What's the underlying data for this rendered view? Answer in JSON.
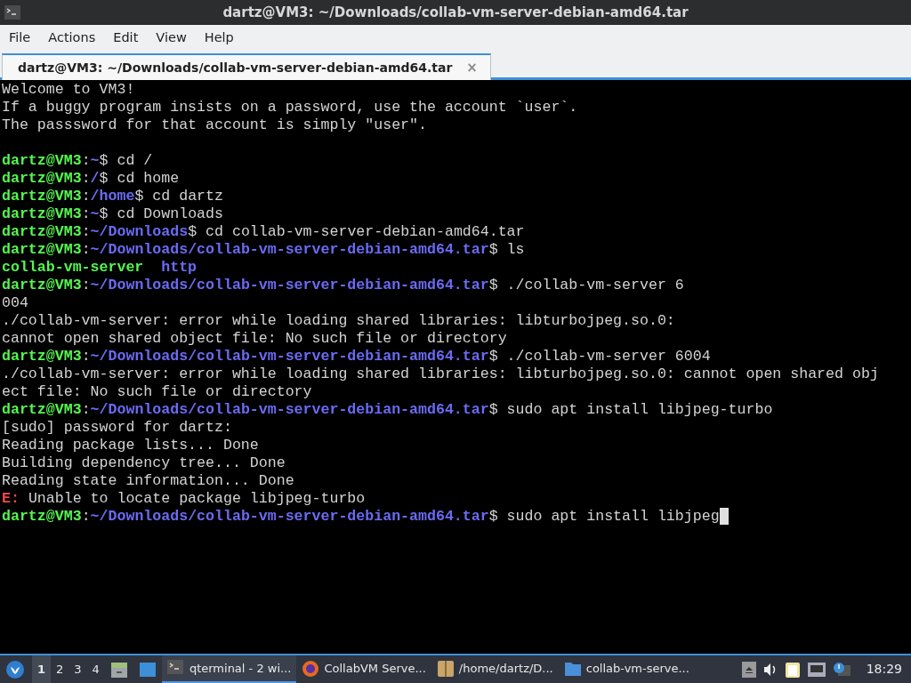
{
  "window": {
    "title": "dartz@VM3: ~/Downloads/collab-vm-server-debian-amd64.tar"
  },
  "menu": [
    "File",
    "Actions",
    "Edit",
    "View",
    "Help"
  ],
  "tabs": [
    {
      "label": "dartz@VM3: ~/Downloads/collab-vm-server-debian-amd64.tar",
      "selected": true,
      "close": "×"
    }
  ],
  "terminal": {
    "lines": [
      {
        "segments": [
          {
            "kind": "text",
            "text": "Welcome to VM3!"
          }
        ]
      },
      {
        "segments": [
          {
            "kind": "text",
            "text": "If a buggy program insists on a password, use the account `user`."
          }
        ]
      },
      {
        "segments": [
          {
            "kind": "text",
            "text": "The passsword for that account is simply \"user\"."
          }
        ]
      },
      {
        "blank": true
      },
      {
        "segments": [
          {
            "kind": "user",
            "text": "dartz@VM3"
          },
          {
            "kind": "text",
            "text": ":"
          },
          {
            "kind": "path",
            "text": "~"
          },
          {
            "kind": "text",
            "text": "$ cd /"
          }
        ]
      },
      {
        "segments": [
          {
            "kind": "user",
            "text": "dartz@VM3"
          },
          {
            "kind": "text",
            "text": ":"
          },
          {
            "kind": "path",
            "text": "/"
          },
          {
            "kind": "text",
            "text": "$ cd home"
          }
        ]
      },
      {
        "segments": [
          {
            "kind": "user",
            "text": "dartz@VM3"
          },
          {
            "kind": "text",
            "text": ":"
          },
          {
            "kind": "path",
            "text": "/home"
          },
          {
            "kind": "text",
            "text": "$ cd dartz"
          }
        ]
      },
      {
        "segments": [
          {
            "kind": "user",
            "text": "dartz@VM3"
          },
          {
            "kind": "text",
            "text": ":"
          },
          {
            "kind": "path",
            "text": "~"
          },
          {
            "kind": "text",
            "text": "$ cd Downloads"
          }
        ]
      },
      {
        "segments": [
          {
            "kind": "user",
            "text": "dartz@VM3"
          },
          {
            "kind": "text",
            "text": ":"
          },
          {
            "kind": "path",
            "text": "~/Downloads"
          },
          {
            "kind": "text",
            "text": "$ cd collab-vm-server-debian-amd64.tar"
          }
        ]
      },
      {
        "segments": [
          {
            "kind": "user",
            "text": "dartz@VM3"
          },
          {
            "kind": "text",
            "text": ":"
          },
          {
            "kind": "path",
            "text": "~/Downloads/collab-vm-server-debian-amd64.tar"
          },
          {
            "kind": "text",
            "text": "$ ls"
          }
        ]
      },
      {
        "segments": [
          {
            "kind": "exec",
            "text": "collab-vm-server"
          },
          {
            "kind": "dir",
            "text": "http"
          }
        ]
      },
      {
        "segments": [
          {
            "kind": "user",
            "text": "dartz@VM3"
          },
          {
            "kind": "text",
            "text": ":"
          },
          {
            "kind": "path",
            "text": "~/Downloads/collab-vm-server-debian-amd64.tar"
          },
          {
            "kind": "text",
            "text": "$ ./collab-vm-server 6"
          }
        ]
      },
      {
        "segments": [
          {
            "kind": "text",
            "text": "004"
          }
        ]
      },
      {
        "segments": [
          {
            "kind": "text",
            "text": "./collab-vm-server: error while loading shared libraries: libturbojpeg.so.0:"
          }
        ]
      },
      {
        "segments": [
          {
            "kind": "text",
            "text": "cannot open shared object file: No such file or directory"
          }
        ]
      },
      {
        "segments": [
          {
            "kind": "user",
            "text": "dartz@VM3"
          },
          {
            "kind": "text",
            "text": ":"
          },
          {
            "kind": "path",
            "text": "~/Downloads/collab-vm-server-debian-amd64.tar"
          },
          {
            "kind": "text",
            "text": "$ ./collab-vm-server 6004"
          }
        ]
      },
      {
        "segments": [
          {
            "kind": "text",
            "text": "./collab-vm-server: error while loading shared libraries: libturbojpeg.so.0: cannot open shared obj"
          }
        ]
      },
      {
        "segments": [
          {
            "kind": "text",
            "text": "ect file: No such file or directory"
          }
        ]
      },
      {
        "segments": [
          {
            "kind": "user",
            "text": "dartz@VM3"
          },
          {
            "kind": "text",
            "text": ":"
          },
          {
            "kind": "path",
            "text": "~/Downloads/collab-vm-server-debian-amd64.tar"
          },
          {
            "kind": "text",
            "text": "$ sudo apt install libjpeg-turbo"
          }
        ]
      },
      {
        "segments": [
          {
            "kind": "text",
            "text": "[sudo] password for dartz:"
          }
        ]
      },
      {
        "segments": [
          {
            "kind": "text",
            "text": "Reading package lists... Done"
          }
        ]
      },
      {
        "segments": [
          {
            "kind": "text",
            "text": "Building dependency tree... Done"
          }
        ]
      },
      {
        "segments": [
          {
            "kind": "text",
            "text": "Reading state information... Done"
          }
        ]
      },
      {
        "segments": [
          {
            "kind": "error",
            "text": "E:"
          },
          {
            "kind": "text",
            "text": " Unable to locate package libjpeg-turbo"
          }
        ]
      },
      {
        "segments": [
          {
            "kind": "user",
            "text": "dartz@VM3"
          },
          {
            "kind": "text",
            "text": ":"
          },
          {
            "kind": "path",
            "text": "~/Downloads/collab-vm-server-debian-amd64.tar"
          },
          {
            "kind": "text",
            "text": "$ sudo apt install libjpeg"
          }
        ],
        "cursor": true
      }
    ]
  },
  "taskbar": {
    "desktops": [
      {
        "label": "1",
        "selected": true
      },
      {
        "label": "2",
        "selected": false
      },
      {
        "label": "3",
        "selected": false
      },
      {
        "label": "4",
        "selected": false
      }
    ],
    "tasks": [
      {
        "kind": "terminal",
        "label": "qterminal - 2 wi...",
        "selected": true
      },
      {
        "kind": "browser",
        "label": "CollabVM Serve...",
        "selected": false
      },
      {
        "kind": "archive",
        "label": "/home/dartz/D...",
        "selected": false
      },
      {
        "kind": "folder",
        "label": "collab-vm-serve...",
        "selected": false
      }
    ],
    "clock": "18:29"
  }
}
